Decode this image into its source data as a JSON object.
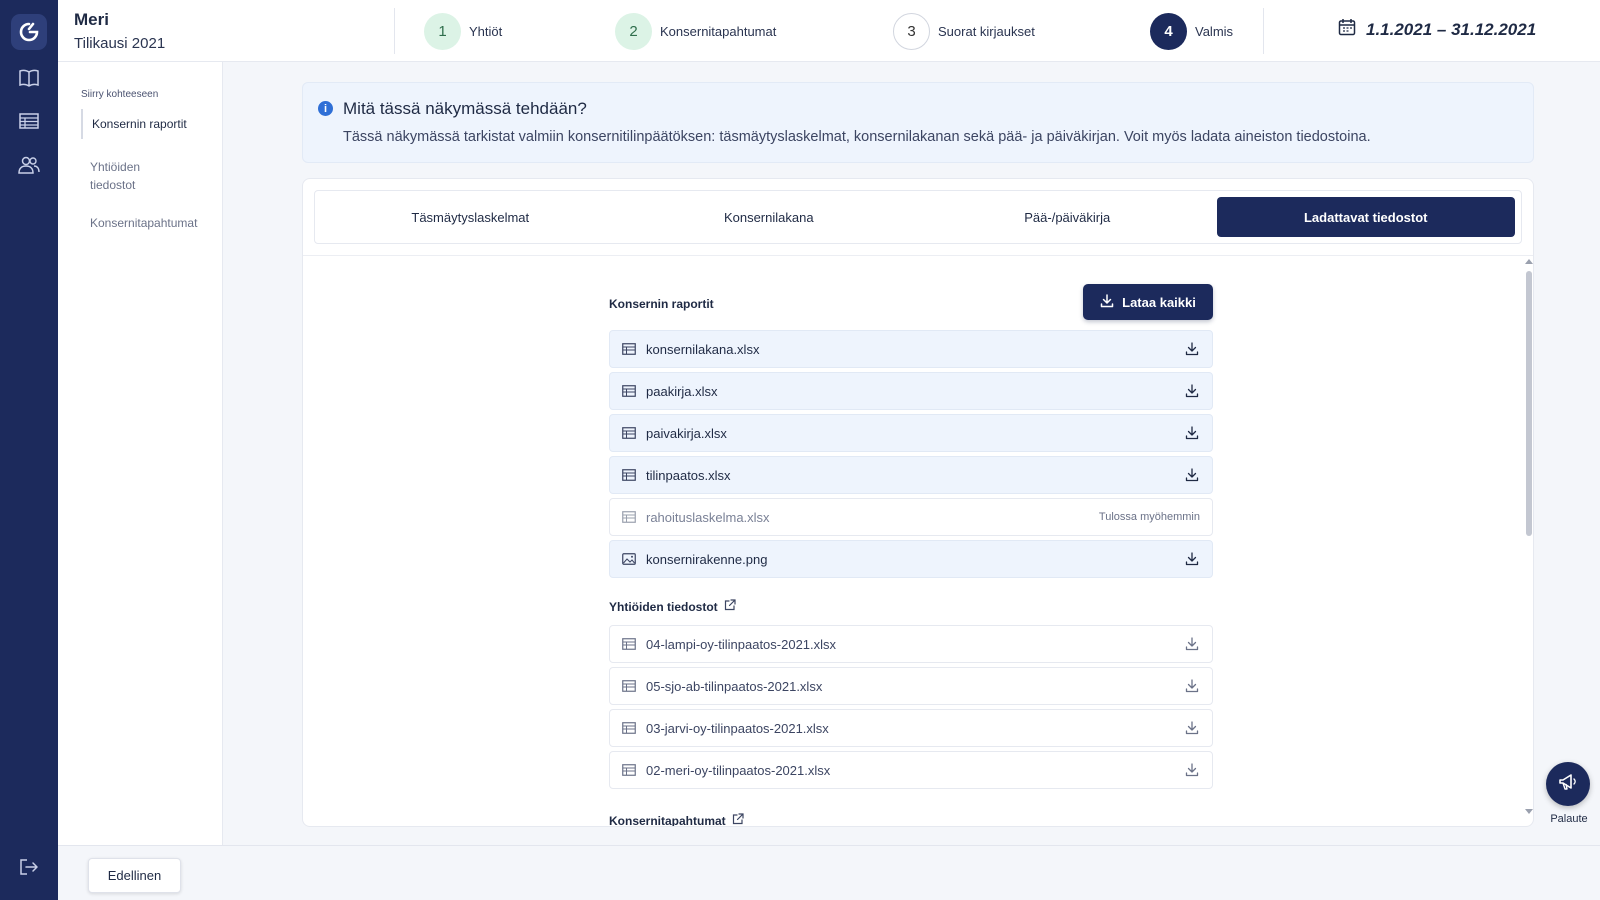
{
  "header": {
    "company_name": "Meri",
    "period": "Tilikausi 2021",
    "date_range": "1.1.2021 – 31.12.2021"
  },
  "steps": [
    {
      "number": "1",
      "label": "Yhtiöt",
      "state": "done"
    },
    {
      "number": "2",
      "label": "Konsernitapahtumat",
      "state": "done"
    },
    {
      "number": "3",
      "label": "Suorat kirjaukset",
      "state": "todo"
    },
    {
      "number": "4",
      "label": "Valmis",
      "state": "current"
    }
  ],
  "sidenav": {
    "title": "Siirry kohteeseen",
    "items": [
      {
        "label": "Konsernin raportit"
      },
      {
        "label": "Yhtiöiden tiedostot"
      },
      {
        "label": "Konsernitapahtumat"
      }
    ]
  },
  "info": {
    "title": "Mitä tässä näkymässä tehdään?",
    "text": "Tässä näkymässä tarkistat valmiin konsernitilinpäätöksen: täsmäytyslaskelmat, konsernilakanan sekä pää- ja päiväkirjan. Voit myös ladata aineiston tiedostoina."
  },
  "tabs": [
    {
      "label": "Täsmäytyslaskelmat"
    },
    {
      "label": "Konsernilakana"
    },
    {
      "label": "Pää-/päiväkirja"
    },
    {
      "label": "Ladattavat tiedostot"
    }
  ],
  "sections": {
    "group_reports": {
      "title": "Konsernin raportit",
      "download_all": "Lataa kaikki",
      "files": [
        {
          "name": "konsernilakana.xlsx",
          "icon": "table-icon"
        },
        {
          "name": "paakirja.xlsx",
          "icon": "table-icon"
        },
        {
          "name": "paivakirja.xlsx",
          "icon": "table-icon"
        },
        {
          "name": "tilinpaatos.xlsx",
          "icon": "table-icon"
        },
        {
          "name": "rahoituslaskelma.xlsx",
          "icon": "table-icon",
          "note": "Tulossa myöhemmin"
        },
        {
          "name": "konsernirakenne.png",
          "icon": "image-icon"
        }
      ]
    },
    "company_files": {
      "title": "Yhtiöiden tiedostot",
      "files": [
        {
          "name": "04-lampi-oy-tilinpaatos-2021.xlsx",
          "icon": "table-icon"
        },
        {
          "name": "05-sjo-ab-tilinpaatos-2021.xlsx",
          "icon": "table-icon"
        },
        {
          "name": "03-jarvi-oy-tilinpaatos-2021.xlsx",
          "icon": "table-icon"
        },
        {
          "name": "02-meri-oy-tilinpaatos-2021.xlsx",
          "icon": "table-icon"
        }
      ]
    },
    "group_events": {
      "title": "Konsernitapahtumat"
    }
  },
  "feedback": {
    "label": "Palaute"
  },
  "footer": {
    "prev_label": "Edellinen"
  },
  "colors": {
    "primary": "#1c2a5c",
    "done_step": "#dcf3e6",
    "info_bg": "#eef4fd"
  }
}
